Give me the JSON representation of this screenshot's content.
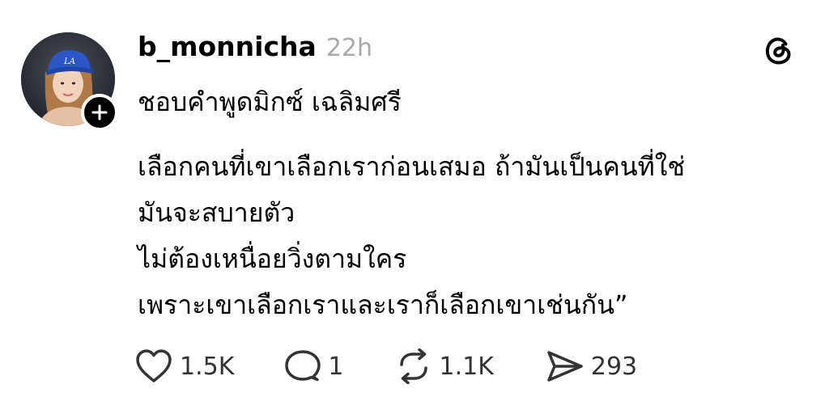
{
  "post": {
    "username": "b_monnicha",
    "timestamp": "22h",
    "quote_line": "ชอบคำพูดมิกซ์ เฉลิมศรี",
    "body_lines": [
      "เลือกคนที่เขาเลือกเราก่อนเสมอ ถ้ามันเป็นคนที่ใช่",
      "มันจะสบายตัว",
      "ไม่ต้องเหนื่อยวิ่งตามใคร",
      "เพราะเขาเลือกเราและเราก็เลือกเขาเช่นกัน”"
    ]
  },
  "actions": {
    "likes": "1.5K",
    "replies": "1",
    "reposts": "1.1K",
    "shares": "293"
  },
  "icons": {
    "like": "heart-icon",
    "reply": "comment-icon",
    "repost": "repost-icon",
    "share": "send-icon",
    "follow": "plus-icon",
    "brand": "threads-logo-icon"
  },
  "colors": {
    "text": "#000000",
    "timestamp": "#a8a8a8",
    "action_text": "#333333",
    "cap_blue": "#2a56c6"
  }
}
